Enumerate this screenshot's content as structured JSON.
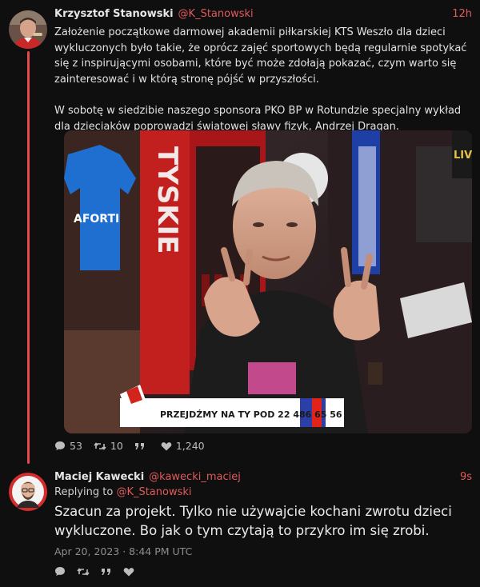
{
  "tweet1": {
    "author_name": "Krzysztof Stanowski",
    "author_handle": "@K_Stanowski",
    "time": "12h",
    "paragraph1": "Założenie początkowe darmowej akademii piłkarskiej KTS Weszło dla dzieci wykluczonych było takie, że oprócz zajęć sportowych będą regularnie spotykać się z inspirującymi osobami, które być może zdołają pokazać, czym warto się zainteresować i w którą stronę pójść w przyszłości.",
    "paragraph2": "W sobotę w siedzibie naszego sponsora PKO BP w Rotundzie specjalny wykład dla dzieciaków poprowadzi światowej sławy fizyk, Andrzej Dragan.",
    "media": {
      "sign_text": "TYSKIE",
      "shirt_text": "AFORTI",
      "banner_text": "PRZEJDŹMY NA TY POD 22 486 65 56",
      "corner_text": "LIV"
    },
    "stats": {
      "replies": "53",
      "retweets": "10",
      "quotes": "",
      "likes": "1,240"
    }
  },
  "tweet2": {
    "author_name": "Maciej Kawecki",
    "author_handle": "@kawecki_maciej",
    "time": "9s",
    "replying_label": "Replying to",
    "replying_handle": "@K_Stanowski",
    "text": "Szacun za projekt. Tylko nie używajcie kochani zwrotu dzieci wykluczone. Bo jak o tym czytają to przykro im się zrobi.",
    "date": "Apr 20, 2023 · 8:44 PM UTC"
  },
  "icons": [
    "reply-icon",
    "retweet-icon",
    "quote-icon",
    "like-icon"
  ],
  "colors": {
    "background": "#0f0f0f",
    "accent": "#e05a5a",
    "thread_line": "#e5484d"
  }
}
